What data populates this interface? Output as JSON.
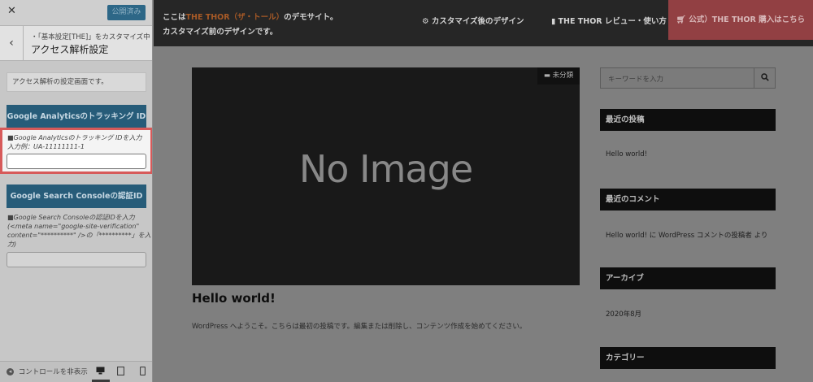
{
  "sidebar": {
    "close_label": "✕",
    "publish_label": "公開済み",
    "back_label": "‹",
    "breadcrumb": "・「基本設定[THE]」をカスタマイズ中",
    "title": "アクセス解析設定",
    "description": "アクセス解析の設定画面です。",
    "ga_heading": "Google Analyticsのトラッキング ID",
    "ga_label_line1": "■Google Analyticsのトラッキング IDを入力",
    "ga_label_line2": "入力例：UA-11111111-1",
    "ga_input_value": "",
    "gsc_heading": "Google Search Consoleの認証ID",
    "gsc_label_line1": "■Google Search Consoleの認証IDを入力",
    "gsc_label_line2": "(<meta name=\"google-site-verification\"",
    "gsc_label_line3": "content=\"**********\" />の「**********」を入",
    "gsc_label_line4": "力)",
    "gsc_input_value": "",
    "hide_controls_label": "コントロールを非表示",
    "devices": [
      "desktop-icon",
      "tablet-icon",
      "mobile-icon"
    ]
  },
  "preview": {
    "site_desc_prefix": "ここは",
    "site_brand": "THE THOR（ザ・トール）",
    "site_desc_suffix": "のデモサイト。",
    "site_desc_line2": "カスタマイズ前のデザインです。",
    "nav_customized": "カスタマイズ後のデザイン",
    "nav_review": "THE THOR レビュー・使い方",
    "nav_buy": "公式）THE THOR 購入はこちら",
    "thumbnail_text": "No Image",
    "category_badge": "未分類",
    "post_title": "Hello world!",
    "post_excerpt": "WordPress へようこそ。こちらは最初の投稿です。編集または削除し、コンテンツ作成を始めてください。",
    "search_placeholder": "キーワードを入力",
    "widgets": {
      "recent_posts_title": "最近の投稿",
      "recent_post_1": "Hello world!",
      "recent_comments_title": "最近のコメント",
      "recent_comment_1": "Hello world! に WordPress コメントの投稿者 より",
      "archive_title": "アーカイブ",
      "archive_1": "2020年8月",
      "category_title": "カテゴリー"
    }
  },
  "colors": {
    "publish": "#2d6787",
    "section_button": "#275c79",
    "highlight_border": "#d75a5a",
    "topbar": "#262626",
    "brand": "#a85a26",
    "buy_button": "#924043"
  }
}
